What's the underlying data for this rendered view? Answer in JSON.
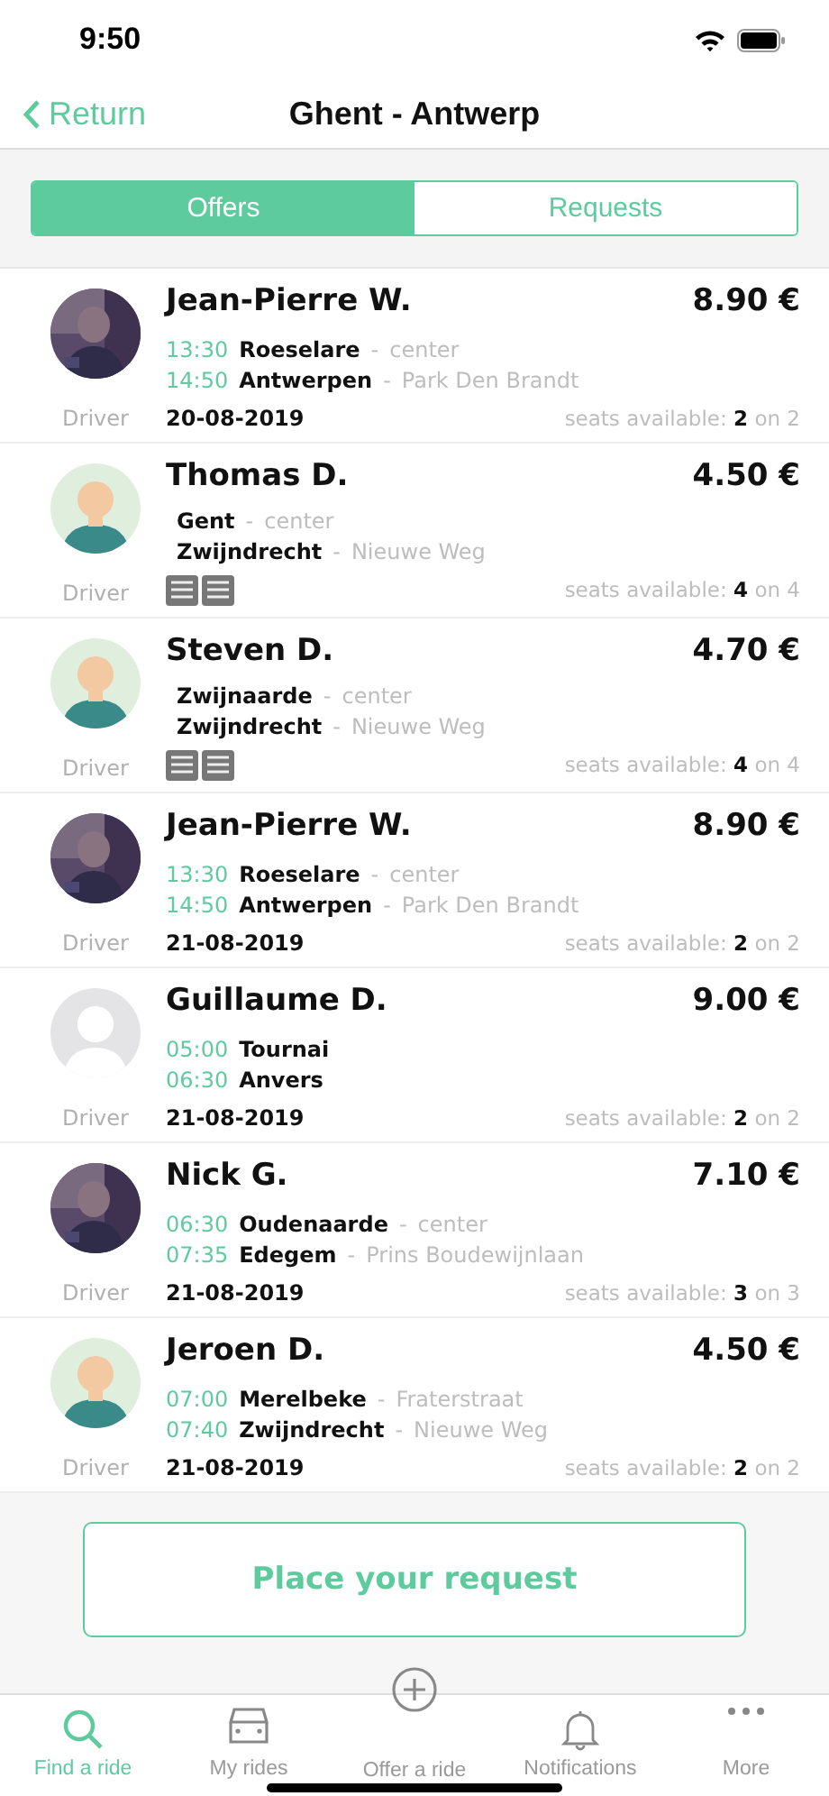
{
  "status_bar": {
    "time": "9:50"
  },
  "nav": {
    "back_label": "Return",
    "title": "Ghent - Antwerp"
  },
  "segments": [
    {
      "label": "Offers",
      "selected": true
    },
    {
      "label": "Requests",
      "selected": false
    }
  ],
  "rides": [
    {
      "name": "Jean-Pierre W.",
      "price": "8.90 €",
      "role": "Driver",
      "stops": [
        {
          "time": "13:30",
          "city": "Roeselare",
          "dash": "-",
          "place": "center"
        },
        {
          "time": "14:50",
          "city": "Antwerpen",
          "dash": "-",
          "place": "Park Den Brandt"
        }
      ],
      "footer": {
        "kind": "date",
        "date": "20-08-2019"
      },
      "seats": "seats available: **2** on 2"
    },
    {
      "avatar": {
        "kind": "cartoon"
      },
      "name": "Thomas D.",
      "price": "4.50 €",
      "role": "Driver",
      "stops": [
        {
          "city": "Gent",
          "dash": "-",
          "place": "center"
        },
        {
          "city": "Zwijndrecht",
          "dash": "-",
          "place": "Nieuwe Weg"
        }
      ],
      "footer": {
        "kind": "seats_icon"
      },
      "seats": "seats available: **4** on 4"
    },
    {
      "avatar": {
        "kind": "cartoon"
      },
      "name": "Steven D.",
      "price": "4.70 €",
      "role": "Driver",
      "stops": [
        {
          "city": "Zwijnaarde",
          "dash": "-",
          "place": "center"
        },
        {
          "city": "Zwijndrecht",
          "dash": "-",
          "place": "Nieuwe Weg"
        }
      ],
      "footer": {
        "kind": "seats_icon"
      },
      "seats": "seats available: **4** on 4"
    },
    {
      "name": "Jean-Pierre W.",
      "price": "8.90 €",
      "role": "Driver",
      "stops": [
        {
          "time": "13:30",
          "city": "Roeselare",
          "dash": "-",
          "place": "center"
        },
        {
          "time": "14:50",
          "city": "Antwerpen",
          "dash": "-",
          "place": "Park Den Brandt"
        }
      ],
      "footer": {
        "kind": "date",
        "date": "21-08-2019"
      },
      "seats": "seats available: **2** on 2"
    },
    {
      "avatar": {
        "kind": "placeholder"
      },
      "name": "Guillaume D.",
      "price": "9.00 €",
      "role": "Driver",
      "stops": [
        {
          "time": "05:00",
          "city": "Tournai"
        },
        {
          "time": "06:30",
          "city": "Anvers"
        }
      ],
      "footer": {
        "kind": "date",
        "date": "21-08-2019"
      },
      "seats": "seats available: **2** on 2"
    },
    {
      "name": "Nick G.",
      "price": "7.10 €",
      "role": "Driver",
      "stops": [
        {
          "time": "06:30",
          "city": "Oudenaarde",
          "dash": "-",
          "place": "center"
        },
        {
          "time": "07:35",
          "city": "Edegem",
          "dash": "-",
          "place": "Prins Boudewijnlaan"
        }
      ],
      "footer": {
        "kind": "date",
        "date": "21-08-2019"
      },
      "seats": "seats available: **3** on 3"
    },
    {
      "avatar": {
        "kind": "cartoon"
      },
      "name": "Jeroen D.",
      "price": "4.50 €",
      "role": "Driver",
      "stops": [
        {
          "time": "07:00",
          "city": "Merelbeke",
          "dash": "-",
          "place": "Fraterstraat"
        },
        {
          "time": "07:40",
          "city": "Zwijndrecht",
          "dash": "-",
          "place": "Nieuwe Weg"
        }
      ],
      "footer": {
        "kind": "date",
        "date": "21-08-2019"
      },
      "seats": "seats available: **2** on 2"
    }
  ],
  "request_button": "Place your request",
  "tab_bar": [
    {
      "kind": "search",
      "label": "Find a ride",
      "selected": true
    },
    {
      "kind": "car",
      "label": "My rides",
      "selected": false
    },
    {
      "kind": "plus",
      "label": "Offer a ride",
      "selected": false
    },
    {
      "kind": "bell",
      "label": "Notifications",
      "selected": false
    },
    {
      "kind": "more",
      "label": "More",
      "selected": false
    }
  ]
}
